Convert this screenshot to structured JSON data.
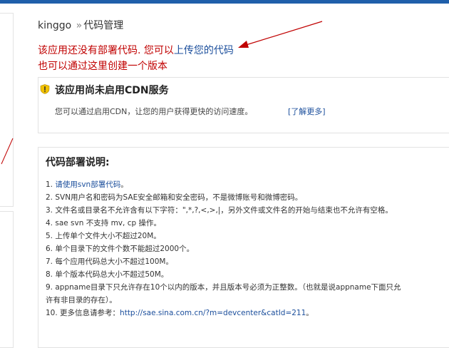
{
  "breadcrumb": {
    "app": "kinggo",
    "separator": "»",
    "page": "代码管理"
  },
  "annotation": {
    "line1_prefix": "该应用还没有部署代码. 您可以",
    "line1_link": "上传您的代码",
    "line2": "也可以通过这里创建一个版本"
  },
  "cdn": {
    "title": "该应用尚未启用CDN服务",
    "description": "您可以通过启用CDN，让您的用户获得更快的访问速度。",
    "more_link": "[了解更多]"
  },
  "deploy": {
    "title": "代码部署说明:",
    "items": {
      "i1_num": "1. ",
      "i1_link": "请使用svn部署代码",
      "i1_end": "。",
      "i2": "2. SVN用户名和密码为SAE安全邮箱和安全密码，不是微博账号和微博密码。",
      "i3": "3. 文件名或目录名不允许含有以下字符：\",*,?,<,>,|，另外文件或文件名的开始与结束也不允许有空格。",
      "i4": "4. sae svn 不支持 mv, cp 操作。",
      "i5": "5. 上传单个文件大小不超过20M。",
      "i6": "6. 单个目录下的文件个数不能超过2000个。",
      "i7": "7. 每个应用代码总大小不超过100M。",
      "i8": "8. 单个版本代码总大小不超过50M。",
      "i9a": "9. appname目录下只允许存在10个以内的版本，并且版本号必须为正整数。（也就是说appname下面只允",
      "i9b": "许有非目录的存在）。",
      "i10_prefix": "10. 更多信息请参考：",
      "i10_link": "http://sae.sina.com.cn/?m=devcenter&catId=211",
      "i10_end": "。"
    }
  },
  "colors": {
    "topbar": "#1f5faa",
    "annotation": "#c00000",
    "link": "#1c4f9c"
  }
}
